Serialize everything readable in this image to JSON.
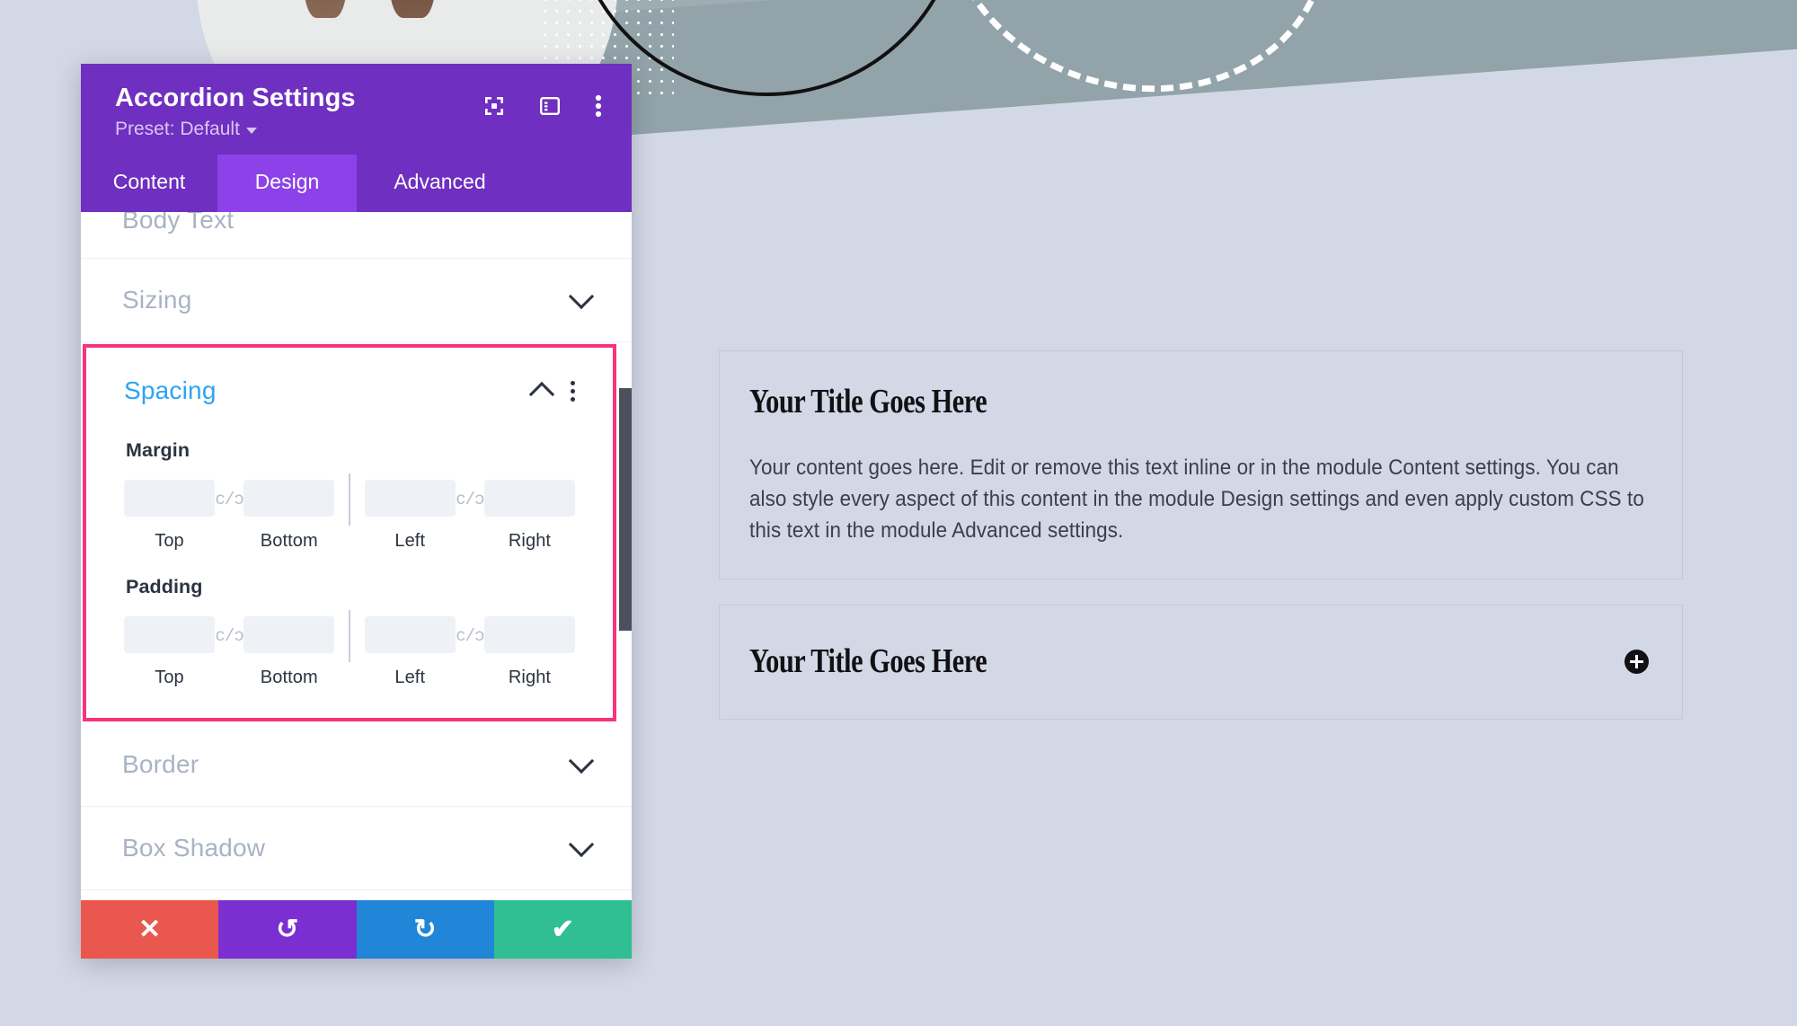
{
  "modal": {
    "title": "Accordion Settings",
    "preset_label": "Preset: Default",
    "icons": {
      "focus": "focus-target-icon",
      "layout": "panel-layout-icon",
      "more": "kebab-menu-icon"
    },
    "tabs": [
      {
        "label": "Content",
        "active": false
      },
      {
        "label": "Design",
        "active": true
      },
      {
        "label": "Advanced",
        "active": false
      }
    ],
    "sections": [
      {
        "label": "Body Text",
        "state": "collapsed",
        "cutoff": true
      },
      {
        "label": "Sizing",
        "state": "collapsed"
      },
      {
        "label": "Spacing",
        "state": "open",
        "highlighted": true
      },
      {
        "label": "Border",
        "state": "collapsed"
      },
      {
        "label": "Box Shadow",
        "state": "collapsed"
      }
    ],
    "spacing": {
      "title": "Spacing",
      "groups": [
        {
          "label": "Margin",
          "fields": [
            {
              "caption": "Top",
              "value": "",
              "placeholder": ""
            },
            {
              "caption": "Bottom",
              "value": "",
              "placeholder": ""
            },
            {
              "caption": "Left",
              "value": "",
              "placeholder": ""
            },
            {
              "caption": "Right",
              "value": "",
              "placeholder": ""
            }
          ],
          "link_icon": "c/ɔ"
        },
        {
          "label": "Padding",
          "fields": [
            {
              "caption": "Top",
              "value": "",
              "placeholder": ""
            },
            {
              "caption": "Bottom",
              "value": "",
              "placeholder": ""
            },
            {
              "caption": "Left",
              "value": "",
              "placeholder": ""
            },
            {
              "caption": "Right",
              "value": "",
              "placeholder": ""
            }
          ],
          "link_icon": "c/ɔ"
        }
      ]
    },
    "footer": [
      {
        "name": "cancel-button",
        "glyph": "✕",
        "color": "#e9574f"
      },
      {
        "name": "undo-button",
        "glyph": "↺",
        "color": "#7b2fd0"
      },
      {
        "name": "redo-button",
        "glyph": "↻",
        "color": "#2186d7"
      },
      {
        "name": "save-button",
        "glyph": "✔",
        "color": "#2fbf93"
      }
    ]
  },
  "preview": {
    "items": [
      {
        "title": "Your Title Goes Here",
        "body": "Your content goes here. Edit or remove this text inline or in the module Content settings. You can also style every aspect of this content in the module Design settings and even apply custom CSS to this text in the module Advanced settings.",
        "expanded": true
      },
      {
        "title": "Your Title Goes Here",
        "body": "",
        "expanded": false,
        "toggle_icon": "plus-circle-icon"
      }
    ]
  },
  "colors": {
    "page_background": "#d3d8e6",
    "modal_purple": "#6f2fc0",
    "tab_active_purple": "#8c42e8",
    "highlight_pink": "#f7337e",
    "section_open_blue": "#2ea3f2",
    "input_background": "#eef1f6",
    "deco_slate": "#92a4a9"
  }
}
